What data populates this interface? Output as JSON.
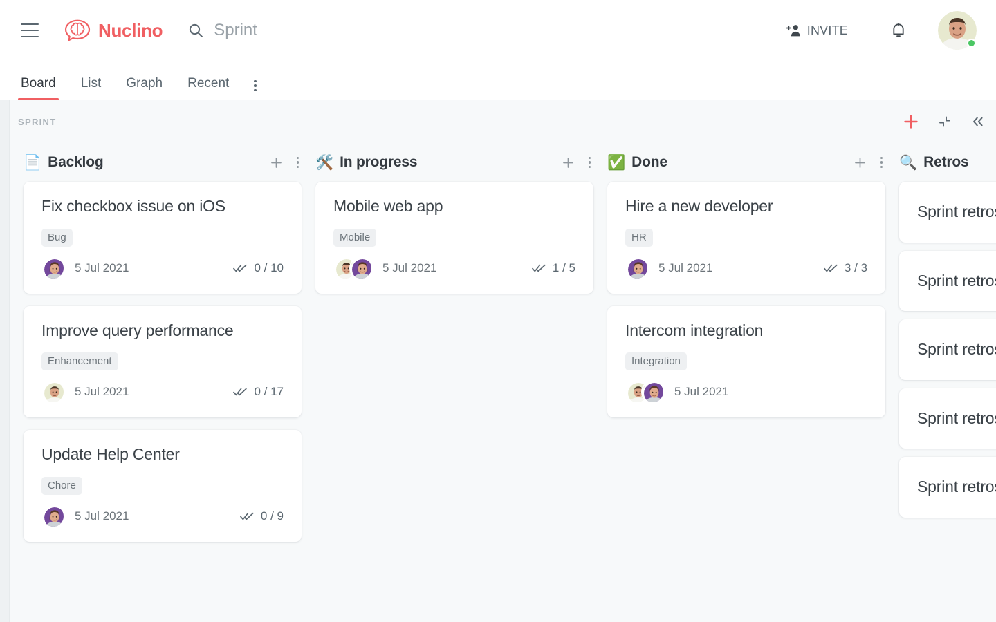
{
  "header": {
    "menu_icon": "hamburger-icon",
    "brand_name": "Nuclino",
    "brand_logo_icon": "brain-bubble-logo-icon",
    "search": {
      "icon": "search-icon",
      "value": "Sprint",
      "placeholder": "Search"
    },
    "invite": {
      "icon": "person-add-icon",
      "label": "INVITE"
    },
    "notifications_icon": "bell-icon",
    "avatar": {
      "icon": "user-avatar",
      "status": "online"
    }
  },
  "tabs": [
    {
      "label": "Board",
      "active": true
    },
    {
      "label": "List",
      "active": false
    },
    {
      "label": "Graph",
      "active": false
    },
    {
      "label": "Recent",
      "active": false
    }
  ],
  "tabs_more_icon": "more-vertical-icon",
  "board": {
    "title": "SPRINT",
    "tools": [
      {
        "name": "add-item-button",
        "icon": "plus-icon"
      },
      {
        "name": "collapse-view-button",
        "icon": "collapse-corners-icon"
      },
      {
        "name": "collapse-sidebar-button",
        "icon": "double-chevron-left-icon"
      }
    ]
  },
  "colors": {
    "accent": "#f05f62",
    "board_bg": "#f7f9fa",
    "card_bg": "#ffffff",
    "text": "#3b4248",
    "muted": "#6b7379",
    "tag_bg": "#eef0f2",
    "status_online": "#4cc764"
  },
  "columns": [
    {
      "emoji": "📄",
      "emoji_name": "page-facing-up-emoji",
      "name": "Backlog",
      "add_icon": "plus-icon",
      "menu_icon": "more-vertical-icon",
      "cards": [
        {
          "title": "Fix checkbox issue on iOS",
          "tags": [
            "Bug"
          ],
          "avatars": [
            "female-purple"
          ],
          "date": "5 Jul 2021",
          "tasks": "0 / 10",
          "tasks_icon": "double-check-icon"
        },
        {
          "title": "Improve query performance",
          "tags": [
            "Enhancement"
          ],
          "avatars": [
            "male-cream"
          ],
          "date": "5 Jul 2021",
          "tasks": "0 / 17",
          "tasks_icon": "double-check-icon"
        },
        {
          "title": "Update Help Center",
          "tags": [
            "Chore"
          ],
          "avatars": [
            "female-purple"
          ],
          "date": "5 Jul 2021",
          "tasks": "0 / 9",
          "tasks_icon": "double-check-icon"
        }
      ]
    },
    {
      "emoji": "🛠️",
      "emoji_name": "hammer-and-wrench-emoji",
      "name": "In progress",
      "add_icon": "plus-icon",
      "menu_icon": "more-vertical-icon",
      "cards": [
        {
          "title": "Mobile web app",
          "tags": [
            "Mobile"
          ],
          "avatars": [
            "male-cream",
            "female-purple"
          ],
          "date": "5 Jul 2021",
          "tasks": "1 / 5",
          "tasks_icon": "double-check-icon"
        }
      ]
    },
    {
      "emoji": "✅",
      "emoji_name": "check-mark-button-emoji",
      "name": "Done",
      "add_icon": "plus-icon",
      "menu_icon": "more-vertical-icon",
      "cards": [
        {
          "title": "Hire a new developer",
          "tags": [
            "HR"
          ],
          "avatars": [
            "female-purple"
          ],
          "date": "5 Jul 2021",
          "tasks": "3 / 3",
          "tasks_icon": "double-check-icon"
        },
        {
          "title": "Intercom integration",
          "tags": [
            "Integration"
          ],
          "avatars": [
            "male-cream",
            "female-purple"
          ],
          "date": "5 Jul 2021",
          "tasks": "",
          "tasks_icon": ""
        }
      ]
    },
    {
      "emoji": "🔍",
      "emoji_name": "magnifying-glass-emoji",
      "name": "Retros",
      "add_icon": "",
      "menu_icon": "",
      "cards": [
        {
          "title": "Sprint retrospective",
          "tags": [],
          "avatars": [],
          "date": "",
          "tasks": "",
          "tasks_icon": ""
        },
        {
          "title": "Sprint retrospective",
          "tags": [],
          "avatars": [],
          "date": "",
          "tasks": "",
          "tasks_icon": ""
        },
        {
          "title": "Sprint retrospective",
          "tags": [],
          "avatars": [],
          "date": "",
          "tasks": "",
          "tasks_icon": ""
        },
        {
          "title": "Sprint retrospective",
          "tags": [],
          "avatars": [],
          "date": "",
          "tasks": "",
          "tasks_icon": ""
        },
        {
          "title": "Sprint retrospective",
          "tags": [],
          "avatars": [],
          "date": "",
          "tasks": "",
          "tasks_icon": ""
        }
      ]
    }
  ]
}
